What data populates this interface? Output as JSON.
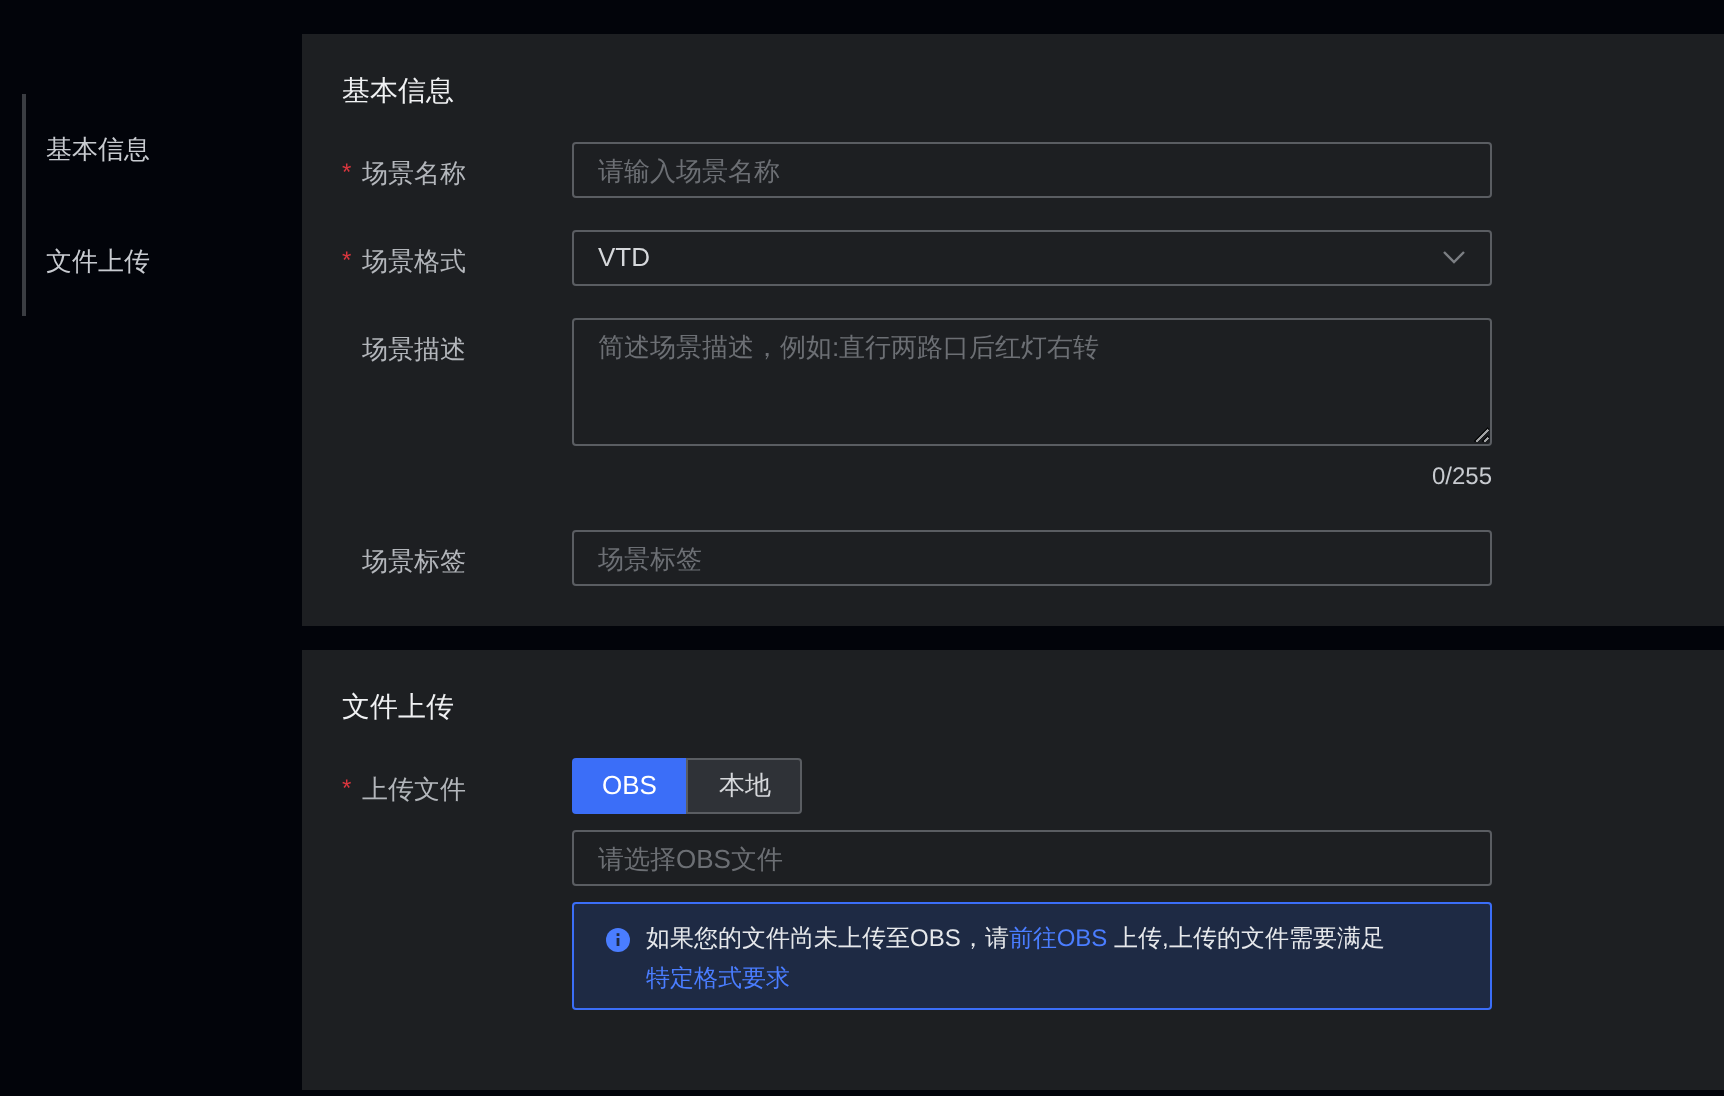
{
  "sidebar": {
    "items": [
      {
        "label": "基本信息",
        "selected": false
      },
      {
        "label": "文件上传",
        "selected": false
      }
    ]
  },
  "sections": [
    {
      "title": "基本信息",
      "fields": [
        {
          "kind": "input",
          "label": "场景名称",
          "required_mark": "*",
          "placeholder": "请输入场景名称"
        },
        {
          "kind": "select",
          "label": "场景格式",
          "required_mark": "*",
          "value": "VTD"
        },
        {
          "kind": "textarea",
          "label": "场景描述",
          "placeholder": "简述场景描述，例如:直行两路口后红灯右转",
          "counter": "0/255"
        },
        {
          "kind": "input",
          "label": "场景标签",
          "placeholder": "场景标签"
        }
      ]
    },
    {
      "title": "文件上传",
      "fields": [
        {
          "kind": "upload",
          "label": "上传文件",
          "required_mark": "*",
          "options": [
            {
              "label": "OBS",
              "selected": true
            },
            {
              "label": "本地",
              "selected": false
            }
          ],
          "placeholder": "请选择OBS文件",
          "message": [
            {
              "kind": "text",
              "text": "如果您的文件尚未上传至OBS，请"
            },
            {
              "kind": "link",
              "text": "前往OBS"
            },
            {
              "kind": "text",
              "text": " 上传,上传的文件需要满足 "
            },
            {
              "kind": "link",
              "text": "特定格式要求"
            }
          ]
        }
      ]
    }
  ]
}
